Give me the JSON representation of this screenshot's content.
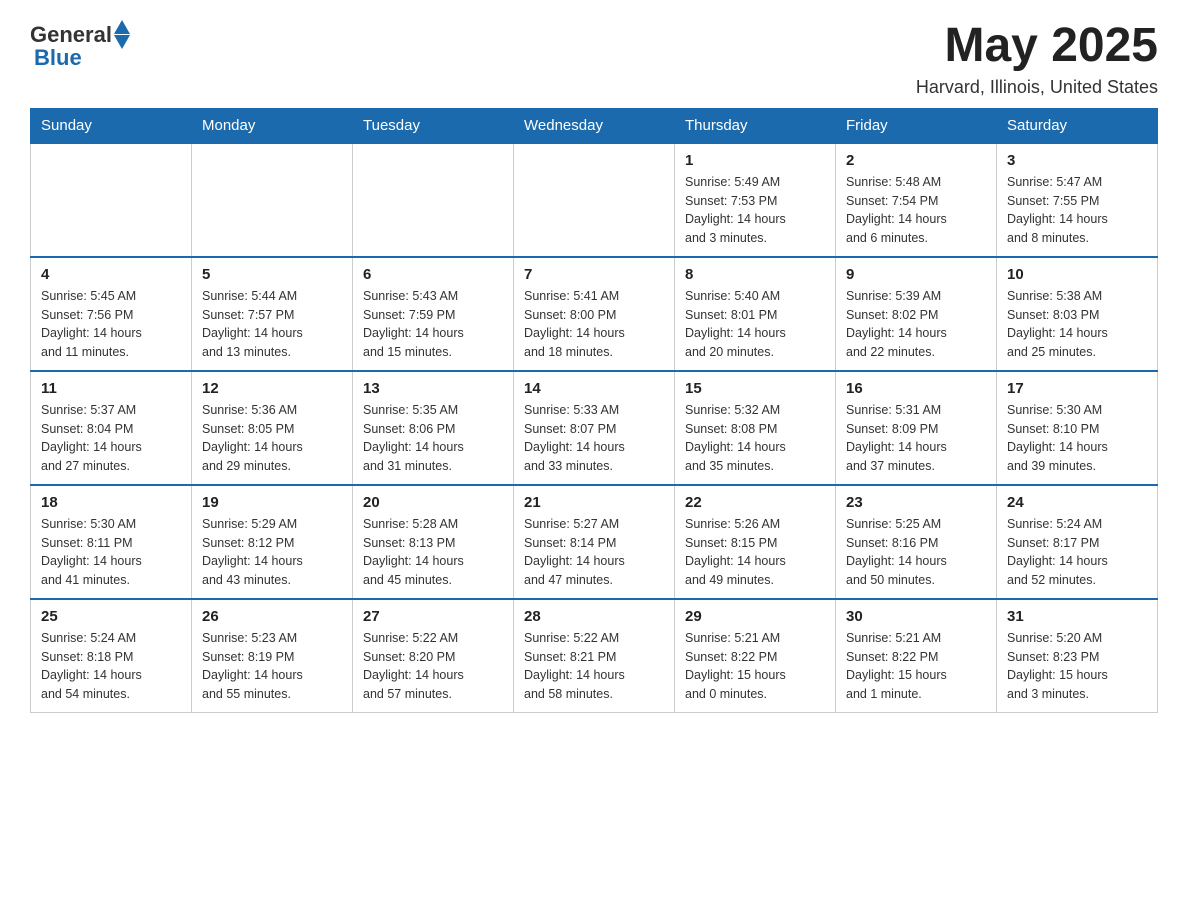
{
  "header": {
    "logo_general": "General",
    "logo_blue": "Blue",
    "month_title": "May 2025",
    "location": "Harvard, Illinois, United States"
  },
  "days_of_week": [
    "Sunday",
    "Monday",
    "Tuesday",
    "Wednesday",
    "Thursday",
    "Friday",
    "Saturday"
  ],
  "weeks": [
    {
      "days": [
        {
          "num": "",
          "info": ""
        },
        {
          "num": "",
          "info": ""
        },
        {
          "num": "",
          "info": ""
        },
        {
          "num": "",
          "info": ""
        },
        {
          "num": "1",
          "info": "Sunrise: 5:49 AM\nSunset: 7:53 PM\nDaylight: 14 hours\nand 3 minutes."
        },
        {
          "num": "2",
          "info": "Sunrise: 5:48 AM\nSunset: 7:54 PM\nDaylight: 14 hours\nand 6 minutes."
        },
        {
          "num": "3",
          "info": "Sunrise: 5:47 AM\nSunset: 7:55 PM\nDaylight: 14 hours\nand 8 minutes."
        }
      ]
    },
    {
      "days": [
        {
          "num": "4",
          "info": "Sunrise: 5:45 AM\nSunset: 7:56 PM\nDaylight: 14 hours\nand 11 minutes."
        },
        {
          "num": "5",
          "info": "Sunrise: 5:44 AM\nSunset: 7:57 PM\nDaylight: 14 hours\nand 13 minutes."
        },
        {
          "num": "6",
          "info": "Sunrise: 5:43 AM\nSunset: 7:59 PM\nDaylight: 14 hours\nand 15 minutes."
        },
        {
          "num": "7",
          "info": "Sunrise: 5:41 AM\nSunset: 8:00 PM\nDaylight: 14 hours\nand 18 minutes."
        },
        {
          "num": "8",
          "info": "Sunrise: 5:40 AM\nSunset: 8:01 PM\nDaylight: 14 hours\nand 20 minutes."
        },
        {
          "num": "9",
          "info": "Sunrise: 5:39 AM\nSunset: 8:02 PM\nDaylight: 14 hours\nand 22 minutes."
        },
        {
          "num": "10",
          "info": "Sunrise: 5:38 AM\nSunset: 8:03 PM\nDaylight: 14 hours\nand 25 minutes."
        }
      ]
    },
    {
      "days": [
        {
          "num": "11",
          "info": "Sunrise: 5:37 AM\nSunset: 8:04 PM\nDaylight: 14 hours\nand 27 minutes."
        },
        {
          "num": "12",
          "info": "Sunrise: 5:36 AM\nSunset: 8:05 PM\nDaylight: 14 hours\nand 29 minutes."
        },
        {
          "num": "13",
          "info": "Sunrise: 5:35 AM\nSunset: 8:06 PM\nDaylight: 14 hours\nand 31 minutes."
        },
        {
          "num": "14",
          "info": "Sunrise: 5:33 AM\nSunset: 8:07 PM\nDaylight: 14 hours\nand 33 minutes."
        },
        {
          "num": "15",
          "info": "Sunrise: 5:32 AM\nSunset: 8:08 PM\nDaylight: 14 hours\nand 35 minutes."
        },
        {
          "num": "16",
          "info": "Sunrise: 5:31 AM\nSunset: 8:09 PM\nDaylight: 14 hours\nand 37 minutes."
        },
        {
          "num": "17",
          "info": "Sunrise: 5:30 AM\nSunset: 8:10 PM\nDaylight: 14 hours\nand 39 minutes."
        }
      ]
    },
    {
      "days": [
        {
          "num": "18",
          "info": "Sunrise: 5:30 AM\nSunset: 8:11 PM\nDaylight: 14 hours\nand 41 minutes."
        },
        {
          "num": "19",
          "info": "Sunrise: 5:29 AM\nSunset: 8:12 PM\nDaylight: 14 hours\nand 43 minutes."
        },
        {
          "num": "20",
          "info": "Sunrise: 5:28 AM\nSunset: 8:13 PM\nDaylight: 14 hours\nand 45 minutes."
        },
        {
          "num": "21",
          "info": "Sunrise: 5:27 AM\nSunset: 8:14 PM\nDaylight: 14 hours\nand 47 minutes."
        },
        {
          "num": "22",
          "info": "Sunrise: 5:26 AM\nSunset: 8:15 PM\nDaylight: 14 hours\nand 49 minutes."
        },
        {
          "num": "23",
          "info": "Sunrise: 5:25 AM\nSunset: 8:16 PM\nDaylight: 14 hours\nand 50 minutes."
        },
        {
          "num": "24",
          "info": "Sunrise: 5:24 AM\nSunset: 8:17 PM\nDaylight: 14 hours\nand 52 minutes."
        }
      ]
    },
    {
      "days": [
        {
          "num": "25",
          "info": "Sunrise: 5:24 AM\nSunset: 8:18 PM\nDaylight: 14 hours\nand 54 minutes."
        },
        {
          "num": "26",
          "info": "Sunrise: 5:23 AM\nSunset: 8:19 PM\nDaylight: 14 hours\nand 55 minutes."
        },
        {
          "num": "27",
          "info": "Sunrise: 5:22 AM\nSunset: 8:20 PM\nDaylight: 14 hours\nand 57 minutes."
        },
        {
          "num": "28",
          "info": "Sunrise: 5:22 AM\nSunset: 8:21 PM\nDaylight: 14 hours\nand 58 minutes."
        },
        {
          "num": "29",
          "info": "Sunrise: 5:21 AM\nSunset: 8:22 PM\nDaylight: 15 hours\nand 0 minutes."
        },
        {
          "num": "30",
          "info": "Sunrise: 5:21 AM\nSunset: 8:22 PM\nDaylight: 15 hours\nand 1 minute."
        },
        {
          "num": "31",
          "info": "Sunrise: 5:20 AM\nSunset: 8:23 PM\nDaylight: 15 hours\nand 3 minutes."
        }
      ]
    }
  ]
}
